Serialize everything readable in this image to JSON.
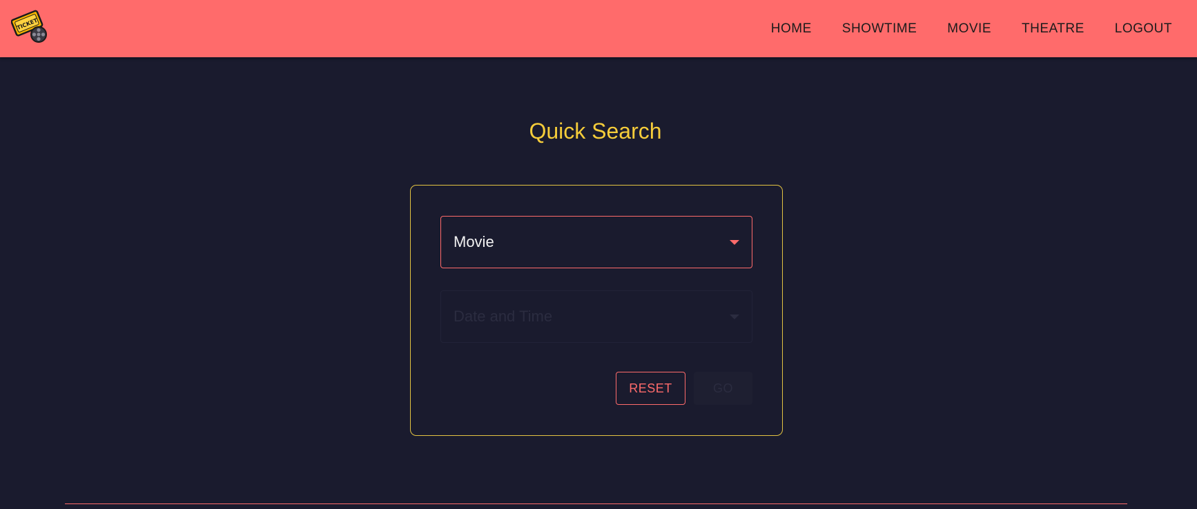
{
  "header": {
    "logo_text": "TICKET",
    "nav": [
      {
        "label": "HOME"
      },
      {
        "label": "SHOWTIME"
      },
      {
        "label": "MOVIE"
      },
      {
        "label": "THEATRE"
      },
      {
        "label": "LOGOUT"
      }
    ]
  },
  "main": {
    "title": "Quick Search",
    "movie_select": {
      "value": "Movie",
      "icon": "caret-down-icon"
    },
    "datetime_select": {
      "value": "Date and Time",
      "icon": "caret-down-icon",
      "disabled": true
    },
    "reset_label": "RESET",
    "go_label": "GO"
  },
  "colors": {
    "navbar": "#ff6b6b",
    "background": "#1a1b2e",
    "title": "#f5cc3a",
    "card_border": "#e4c442",
    "accent": "#ff6b6b"
  }
}
